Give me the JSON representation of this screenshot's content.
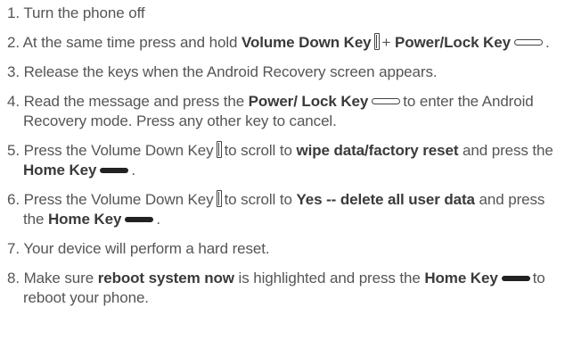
{
  "steps": [
    {
      "number": "1.",
      "parts": [
        {
          "t": "text",
          "v": "Turn the phone off"
        }
      ]
    },
    {
      "number": "2.",
      "parts": [
        {
          "t": "text",
          "v": "At the same time press and hold "
        },
        {
          "t": "bold",
          "v": "Volume Down Key"
        },
        {
          "t": "icon",
          "v": "volume-down-key-icon"
        },
        {
          "t": "text",
          "v": "+ "
        },
        {
          "t": "bold",
          "v": "Power/Lock Key"
        },
        {
          "t": "icon",
          "v": "power-lock-key-icon"
        },
        {
          "t": "text",
          "v": "."
        }
      ]
    },
    {
      "number": "3.",
      "parts": [
        {
          "t": "text",
          "v": "Release the keys when the Android Recovery screen appears."
        }
      ]
    },
    {
      "number": "4.",
      "parts": [
        {
          "t": "text",
          "v": "Read the message and press the "
        },
        {
          "t": "bold",
          "v": "Power/ Lock Key"
        },
        {
          "t": "icon",
          "v": "power-lock-key-icon"
        },
        {
          "t": "text",
          "v": "to enter the Android Recovery mode. Press any other key to cancel."
        }
      ]
    },
    {
      "number": "5.",
      "parts": [
        {
          "t": "text",
          "v": "Press the Volume Down Key"
        },
        {
          "t": "icon",
          "v": "volume-down-key-icon"
        },
        {
          "t": "text",
          "v": "to scroll to "
        },
        {
          "t": "bold",
          "v": "wipe data/factory reset"
        },
        {
          "t": "text",
          "v": " and press the "
        },
        {
          "t": "bold",
          "v": "Home Key"
        },
        {
          "t": "icon",
          "v": "home-key-icon"
        },
        {
          "t": "text",
          "v": "."
        }
      ]
    },
    {
      "number": "6.",
      "parts": [
        {
          "t": "text",
          "v": "Press the Volume Down Key"
        },
        {
          "t": "icon",
          "v": "volume-down-key-icon"
        },
        {
          "t": "text",
          "v": "to scroll to "
        },
        {
          "t": "bold",
          "v": "Yes -- delete all user data"
        },
        {
          "t": "text",
          "v": " and press the "
        },
        {
          "t": "bold",
          "v": "Home Key"
        },
        {
          "t": "icon",
          "v": "home-key-icon"
        },
        {
          "t": "text",
          "v": "."
        }
      ]
    },
    {
      "number": "7.",
      "parts": [
        {
          "t": "text",
          "v": "Your device will perform a hard reset."
        }
      ]
    },
    {
      "number": "8.",
      "parts": [
        {
          "t": "text",
          "v": "Make sure "
        },
        {
          "t": "bold",
          "v": "reboot system now"
        },
        {
          "t": "text",
          "v": " is highlighted and press the "
        },
        {
          "t": "bold",
          "v": "Home Key"
        },
        {
          "t": "icon",
          "v": "home-key-icon"
        },
        {
          "t": "text",
          "v": "to reboot your phone."
        }
      ]
    }
  ]
}
